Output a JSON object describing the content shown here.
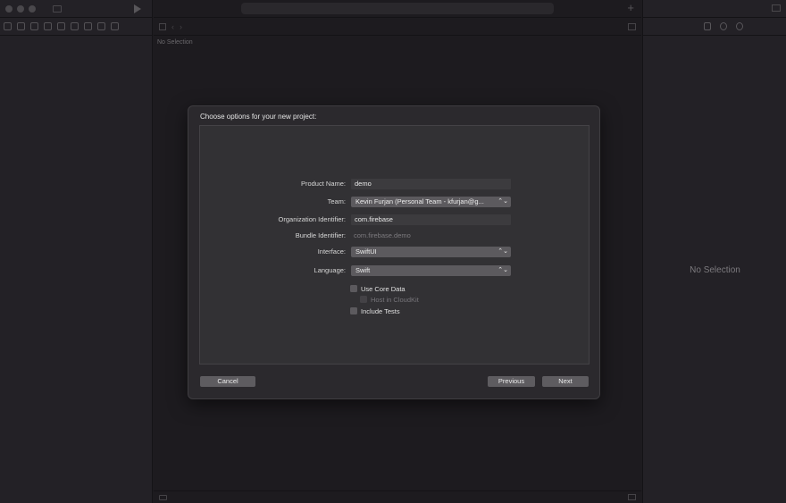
{
  "navigator": {
    "traffic_lights": [
      "close",
      "minimize",
      "zoom"
    ],
    "icons": [
      "folder-icon",
      "source-control-icon",
      "symbol-icon",
      "search-icon",
      "warning-icon",
      "test-icon",
      "debug-icon",
      "breakpoint-icon",
      "report-icon"
    ]
  },
  "editor": {
    "no_selection_label": "No Selection",
    "add_icon": "+"
  },
  "inspector": {
    "no_selection_label": "No Selection",
    "tabs": [
      "file-inspector-icon",
      "history-icon",
      "help-icon"
    ]
  },
  "dialog": {
    "title": "Choose options for your new project:",
    "fields": {
      "product_name": {
        "label": "Product Name:",
        "value": "demo"
      },
      "team": {
        "label": "Team:",
        "value": "Kevin Furjan (Personal Team - kfurjan@g..."
      },
      "organization_identifier": {
        "label": "Organization Identifier:",
        "value": "com.firebase"
      },
      "bundle_identifier": {
        "label": "Bundle Identifier:",
        "value": "com.firebase.demo"
      },
      "interface": {
        "label": "Interface:",
        "value": "SwiftUI"
      },
      "language": {
        "label": "Language:",
        "value": "Swift"
      }
    },
    "checkboxes": {
      "use_core_data": {
        "label": "Use Core Data",
        "checked": false,
        "enabled": true
      },
      "host_in_cloudkit": {
        "label": "Host in CloudKit",
        "checked": false,
        "enabled": false
      },
      "include_tests": {
        "label": "Include Tests",
        "checked": false,
        "enabled": true
      }
    },
    "buttons": {
      "cancel": "Cancel",
      "previous": "Previous",
      "next": "Next"
    },
    "popup_arrows": "⌃⌄"
  },
  "colors": {
    "background": "#1d1b1f",
    "sheet": "#2b292d",
    "panel": "#323134",
    "button": "#5e5c60"
  }
}
